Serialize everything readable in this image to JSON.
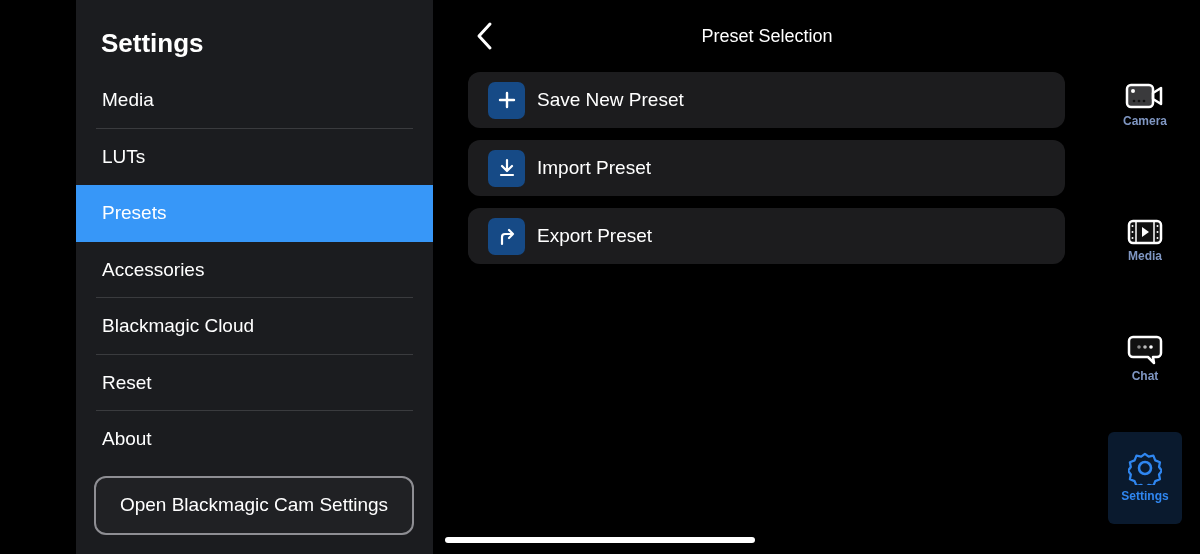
{
  "sidebar": {
    "title": "Settings",
    "items": [
      {
        "label": "Media",
        "selected": false
      },
      {
        "label": "LUTs",
        "selected": false
      },
      {
        "label": "Presets",
        "selected": true
      },
      {
        "label": "Accessories",
        "selected": false
      },
      {
        "label": "Blackmagic Cloud",
        "selected": false
      },
      {
        "label": "Reset",
        "selected": false
      },
      {
        "label": "About",
        "selected": false
      }
    ],
    "button": "Open Blackmagic Cam Settings"
  },
  "header": {
    "title": "Preset Selection"
  },
  "actions": [
    {
      "kind": "add",
      "label": "Save New Preset"
    },
    {
      "kind": "import",
      "label": "Import Preset"
    },
    {
      "kind": "export",
      "label": "Export Preset"
    }
  ],
  "rail": [
    {
      "kind": "camera",
      "label": "Camera",
      "selected": false
    },
    {
      "kind": "media",
      "label": "Media",
      "selected": false
    },
    {
      "kind": "chat",
      "label": "Chat",
      "selected": false
    },
    {
      "kind": "settings",
      "label": "Settings",
      "selected": true
    }
  ]
}
